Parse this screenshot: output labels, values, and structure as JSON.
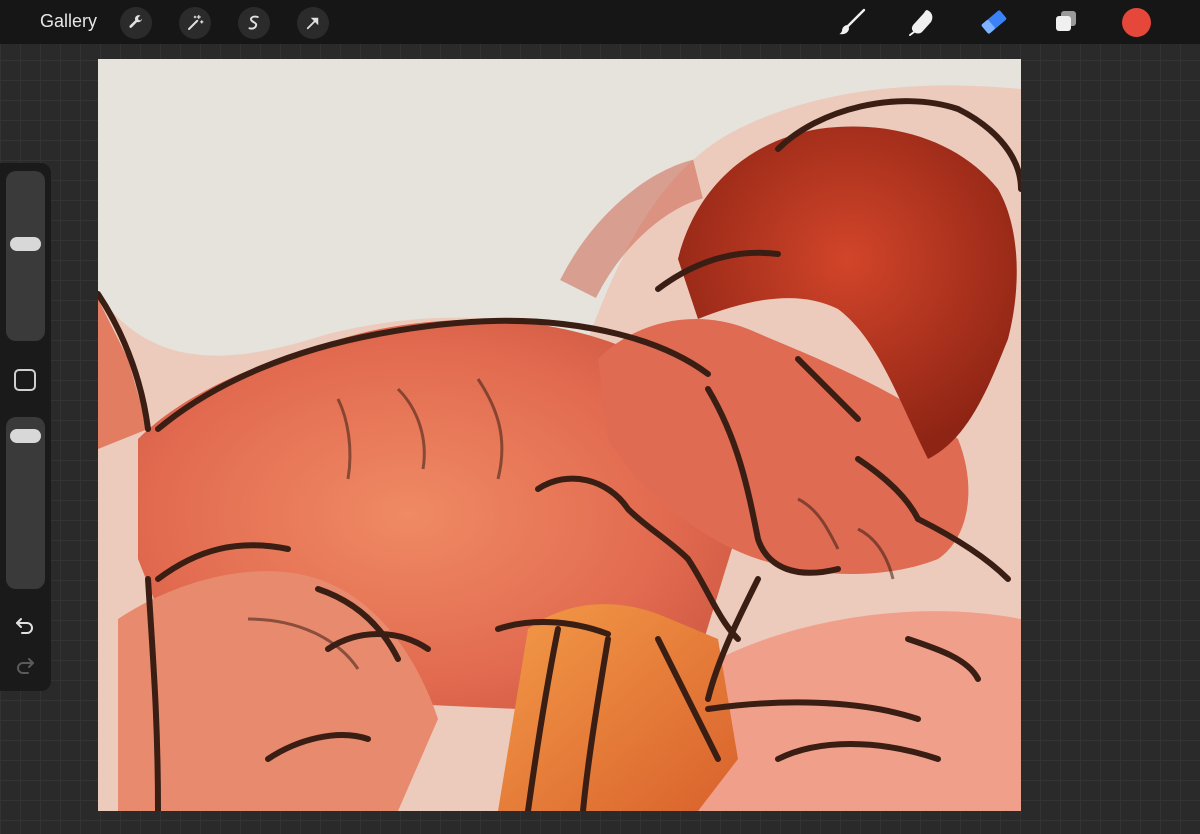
{
  "topbar": {
    "gallery_label": "Gallery",
    "left_tools": [
      "wrench-icon",
      "magic-wand-icon",
      "selection-icon",
      "transform-arrow-icon"
    ],
    "right_tools": [
      "brush-icon",
      "smudge-icon",
      "eraser-icon",
      "layers-icon"
    ],
    "active_tool": "eraser",
    "current_color": "#e5483b"
  },
  "sidebar": {
    "brush_size_level": 0.42,
    "opacity_level": 0.05,
    "icons": [
      "modify-square-icon",
      "undo-icon",
      "redo-icon"
    ]
  },
  "colors": {
    "accent_blue": "#3b82f6",
    "canvas_bg": "#e6e3dd",
    "skin": "#e8745a",
    "hair": "#b8321a",
    "line": "#3a1e14"
  }
}
